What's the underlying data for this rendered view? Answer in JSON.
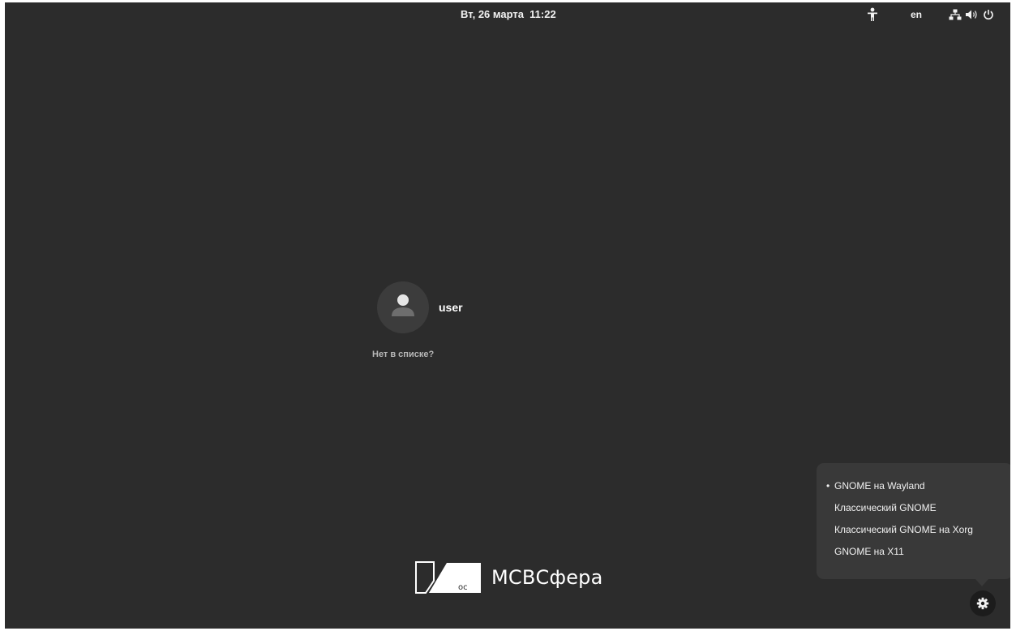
{
  "topbar": {
    "clock": "Вт, 26 марта  11:22",
    "language": "en",
    "icons": [
      "accessibility-icon",
      "network-icon",
      "volume-icon",
      "power-icon"
    ]
  },
  "login": {
    "username": "user",
    "not_listed": "Нет в списке?"
  },
  "branding": {
    "logo_text": "МСВСфера",
    "logo_badge": "ос"
  },
  "session_menu": {
    "selected_marker": "•",
    "items": [
      {
        "label": "GNOME на Wayland",
        "selected": true
      },
      {
        "label": "Классический GNOME",
        "selected": false
      },
      {
        "label": "Классический GNOME на Xorg",
        "selected": false
      },
      {
        "label": "GNOME на X11",
        "selected": false
      }
    ]
  },
  "colors": {
    "background": "#2c2c2c",
    "menu_background": "#393939",
    "avatar_background": "#3c3c3c",
    "text": "#ffffff",
    "muted_text": "#b8b8b8"
  }
}
